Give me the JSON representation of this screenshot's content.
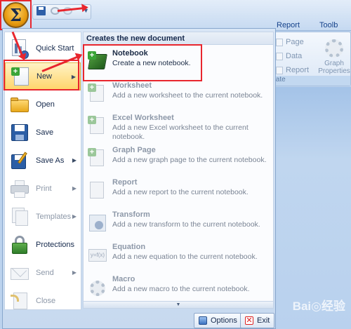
{
  "ribbon": {
    "tabs": [
      "Report",
      "Toolb"
    ],
    "group_items": [
      "Page",
      "Data",
      "Report"
    ],
    "graph_properties": "Graph Properties",
    "group_caption": "igate"
  },
  "app_button": {
    "icon": "sigma-icon",
    "symbol": "Σ"
  },
  "menu": {
    "left_items": [
      {
        "label": "Quick Start",
        "icon": "quick-start-icon",
        "enabled": true,
        "submenu": false
      },
      {
        "label": "New",
        "icon": "new-document-icon",
        "enabled": true,
        "submenu": true,
        "active": true
      },
      {
        "label": "Open",
        "icon": "folder-icon",
        "enabled": true,
        "submenu": false
      },
      {
        "label": "Save",
        "icon": "floppy-disk-icon",
        "enabled": true,
        "submenu": false
      },
      {
        "label": "Save As",
        "icon": "save-as-icon",
        "enabled": true,
        "submenu": true
      },
      {
        "label": "Print",
        "icon": "printer-icon",
        "enabled": false,
        "submenu": true
      },
      {
        "label": "Templates",
        "icon": "templates-icon",
        "enabled": false,
        "submenu": true
      },
      {
        "label": "Protections",
        "icon": "lock-icon",
        "enabled": true,
        "submenu": false
      },
      {
        "label": "Send",
        "icon": "envelope-icon",
        "enabled": false,
        "submenu": true
      },
      {
        "label": "Close",
        "icon": "close-document-icon",
        "enabled": false,
        "submenu": false
      }
    ],
    "right_header": "Creates the new document",
    "new_items": [
      {
        "title": "Notebook",
        "desc": "Create a new notebook.",
        "enabled": true,
        "icon": "notebook-icon"
      },
      {
        "title": "Worksheet",
        "desc": "Add a new worksheet to the current notebook.",
        "enabled": false,
        "icon": "worksheet-icon"
      },
      {
        "title": "Excel Worksheet",
        "desc": "Add a new Excel worksheet to the current notebook.",
        "enabled": false,
        "icon": "excel-worksheet-icon"
      },
      {
        "title": "Graph Page",
        "desc": "Add a new graph page to the current notebook.",
        "enabled": false,
        "icon": "graph-page-icon"
      },
      {
        "title": "Report",
        "desc": "Add a new report to the current notebook.",
        "enabled": false,
        "icon": "report-icon"
      },
      {
        "title": "Transform",
        "desc": "Add a new transform to the current notebook.",
        "enabled": false,
        "icon": "transform-icon"
      },
      {
        "title": "Equation",
        "desc": "Add a new equation to the current notebook.",
        "enabled": false,
        "icon": "equation-icon"
      },
      {
        "title": "Macro",
        "desc": "Add a new macro to the current notebook.",
        "enabled": false,
        "icon": "macro-icon"
      }
    ],
    "footer": {
      "options": "Options",
      "exit": "Exit"
    }
  },
  "colors": {
    "highlight": "#e8262e",
    "menu_active": "#ffd46a",
    "disabled_text": "#8d98a8"
  }
}
